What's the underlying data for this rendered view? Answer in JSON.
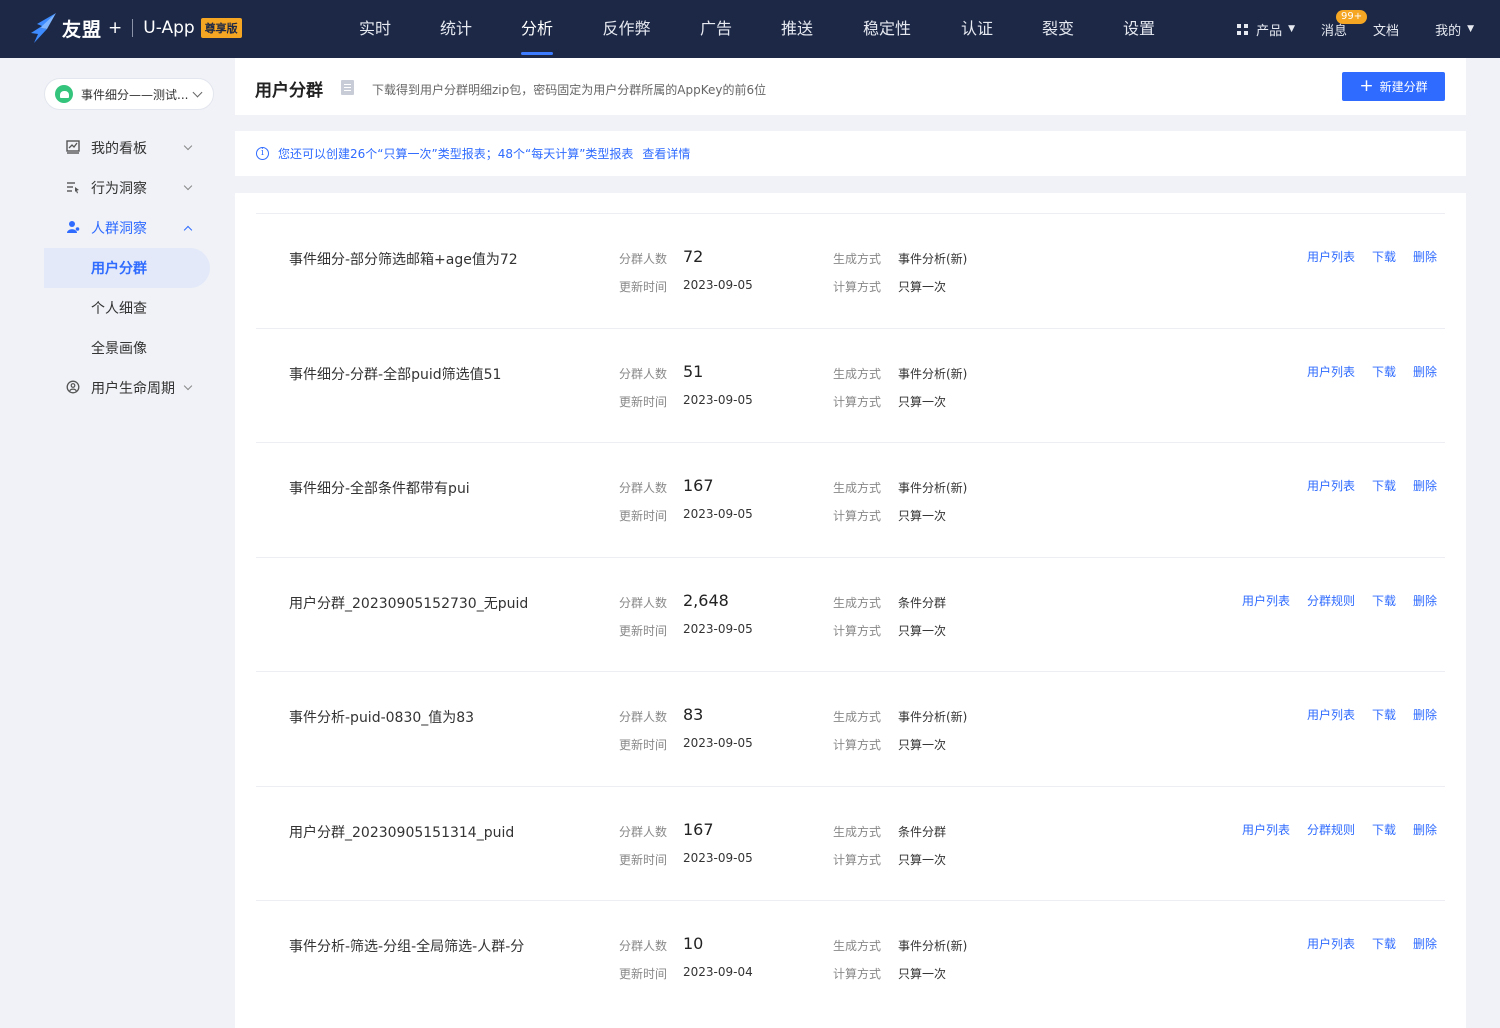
{
  "brand": {
    "name": "友盟",
    "plus": "+",
    "app": "U-App",
    "edition": "尊享版"
  },
  "nav": [
    {
      "label": "实时",
      "width": 80
    },
    {
      "label": "统计",
      "width": 82
    },
    {
      "label": "分析",
      "width": 80,
      "active": true
    },
    {
      "label": "反作弊",
      "width": 99
    },
    {
      "label": "广告",
      "width": 80
    },
    {
      "label": "推送",
      "width": 82
    },
    {
      "label": "稳定性",
      "width": 98
    },
    {
      "label": "认证",
      "width": 82
    },
    {
      "label": "裂变",
      "width": 80
    },
    {
      "label": "设置",
      "width": 82
    }
  ],
  "top_right": {
    "products": "产品",
    "messages": "消息",
    "messages_badge": "99+",
    "docs": "文档",
    "mine": "我的"
  },
  "app_selector": "事件细分——测试...",
  "sidebar": {
    "my_board": "我的看板",
    "behavior": "行为洞察",
    "crowd": "人群洞察",
    "crowd_items": [
      "用户分群",
      "个人细查",
      "全景画像"
    ],
    "lifecycle": "用户生命周期"
  },
  "header": {
    "title": "用户分群",
    "desc": "下载得到用户分群明细zip包，密码固定为用户分群所属的AppKey的前6位",
    "new_button": "新建分群"
  },
  "notice": {
    "text": "您还可以创建26个“只算一次”类型报表；48个“每天计算”类型报表",
    "link": "查看详情"
  },
  "labels": {
    "count": "分群人数",
    "updated": "更新时间",
    "method": "生成方式",
    "calc": "计算方式"
  },
  "segments": [
    {
      "name": "事件细分-部分筛选邮箱+age值为72",
      "count": "72",
      "updated": "2023-09-05",
      "method": "事件分析(新)",
      "calc": "只算一次",
      "actions": [
        "用户列表",
        "下载",
        "删除"
      ]
    },
    {
      "name": "事件细分-分群-全部puid筛选值51",
      "count": "51",
      "updated": "2023-09-05",
      "method": "事件分析(新)",
      "calc": "只算一次",
      "actions": [
        "用户列表",
        "下载",
        "删除"
      ]
    },
    {
      "name": "事件细分-全部条件都带有pui",
      "count": "167",
      "updated": "2023-09-05",
      "method": "事件分析(新)",
      "calc": "只算一次",
      "actions": [
        "用户列表",
        "下载",
        "删除"
      ]
    },
    {
      "name": "用户分群_20230905152730_无puid",
      "count": "2,648",
      "updated": "2023-09-05",
      "method": "条件分群",
      "calc": "只算一次",
      "actions": [
        "用户列表",
        "分群规则",
        "下载",
        "删除"
      ]
    },
    {
      "name": "事件分析-puid-0830_值为83",
      "count": "83",
      "updated": "2023-09-05",
      "method": "事件分析(新)",
      "calc": "只算一次",
      "actions": [
        "用户列表",
        "下载",
        "删除"
      ]
    },
    {
      "name": "用户分群_20230905151314_puid",
      "count": "167",
      "updated": "2023-09-05",
      "method": "条件分群",
      "calc": "只算一次",
      "actions": [
        "用户列表",
        "分群规则",
        "下载",
        "删除"
      ]
    },
    {
      "name": "事件分析-筛选-分组-全局筛选-人群-分",
      "count": "10",
      "updated": "2023-09-04",
      "method": "事件分析(新)",
      "calc": "只算一次",
      "actions": [
        "用户列表",
        "下载",
        "删除"
      ]
    }
  ]
}
